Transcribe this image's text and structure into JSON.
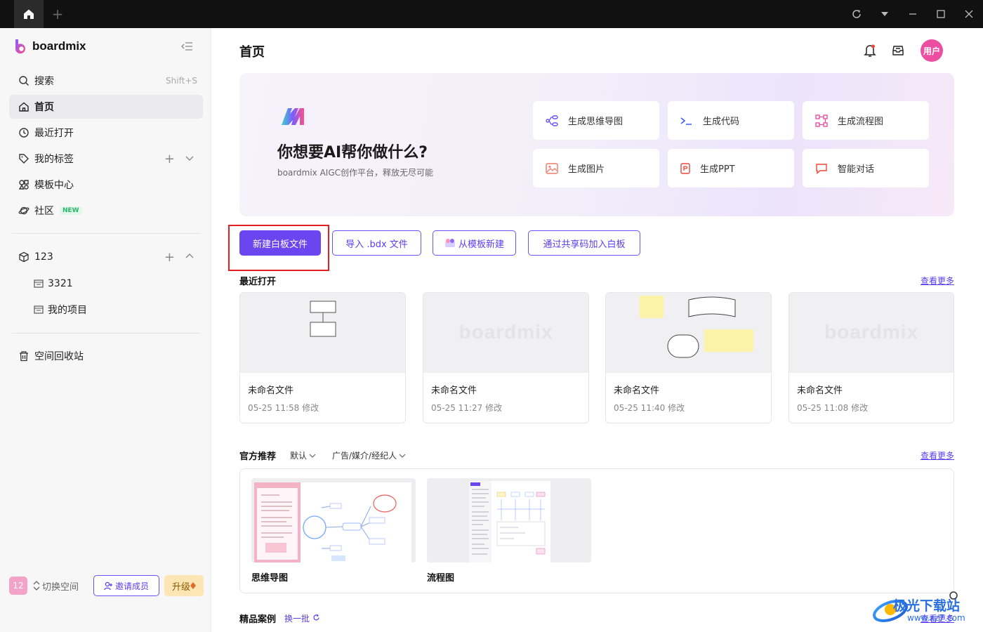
{
  "titlebar": {
    "home_icon": "home-icon",
    "new_tab": "+"
  },
  "sidebar": {
    "brand": "boardmix",
    "search": {
      "label": "搜索",
      "shortcut": "Shift+S"
    },
    "nav": {
      "home": "首页",
      "recent": "最近打开",
      "tags": "我的标签",
      "templates": "模板中心",
      "community": "社区",
      "community_badge": "NEW"
    },
    "workspace": {
      "name": "123",
      "items": [
        "3321",
        "我的项目"
      ]
    },
    "trash": "空间回收站",
    "bottom": {
      "badge": "12",
      "switch": "切换空间",
      "invite": "邀请成员",
      "upgrade": "升级"
    }
  },
  "header": {
    "title": "首页",
    "avatar": "用户"
  },
  "hero": {
    "title": "你想要AI帮你做什么?",
    "subtitle": "boardmix AIGC创作平台，释放无尽可能",
    "cards": [
      "生成思维导图",
      "生成代码",
      "生成流程图",
      "生成图片",
      "生成PPT",
      "智能对话"
    ]
  },
  "actions": {
    "new_board": "新建白板文件",
    "import": "导入 .bdx 文件",
    "from_template": "从模板新建",
    "join_code": "通过共享码加入白板"
  },
  "recent": {
    "title": "最近打开",
    "more": "查看更多",
    "files": [
      {
        "name": "未命名文件",
        "time": "05-25 11:58 修改"
      },
      {
        "name": "未命名文件",
        "time": "05-25 11:27 修改"
      },
      {
        "name": "未命名文件",
        "time": "05-25 11:40 修改"
      },
      {
        "name": "未命名文件",
        "time": "05-25 11:08 修改"
      }
    ],
    "watermark": "boardmix"
  },
  "official": {
    "title": "官方推荐",
    "filter_default": "默认",
    "filter_category": "广告/媒介/经纪人",
    "more": "查看更多",
    "templates": [
      "思维导图",
      "流程图"
    ]
  },
  "cases": {
    "title": "精品案例",
    "refresh": "换一批",
    "more": "查看更多"
  },
  "overlay": {
    "site_name": "极光下载站",
    "site_url": "www.xz7.com"
  },
  "colors": {
    "accent": "#6a45f0",
    "avatar": "#ec4fa1",
    "highlight": "#e02020"
  }
}
